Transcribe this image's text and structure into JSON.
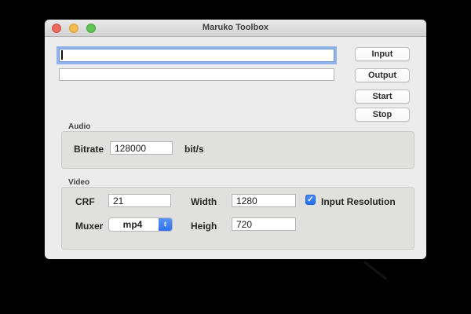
{
  "window": {
    "title": "Maruko Toolbox"
  },
  "paths": {
    "input_field": {
      "value": "",
      "focused": true
    },
    "output_field": {
      "value": ""
    }
  },
  "buttons": {
    "input": "Input",
    "output": "Output",
    "start": "Start",
    "stop": "Stop"
  },
  "audio": {
    "label": "Audio",
    "bitrate_label": "Bitrate",
    "bitrate_value": "128000",
    "bitrate_unit": "bit/s"
  },
  "video": {
    "label": "Video",
    "crf_label": "CRF",
    "crf_value": "21",
    "width_label": "Width",
    "width_value": "1280",
    "input_resolution_label": "Input Resolution",
    "input_resolution_checked": true,
    "muxer_label": "Muxer",
    "muxer_value": "mp4",
    "height_label": "Heigh",
    "height_value": "720"
  },
  "icons": {
    "check": "✓",
    "stepper_up": "▲",
    "stepper_down": "▼"
  },
  "colors": {
    "accent_blue": "#2e7cf6",
    "focus_ring": "#8fb3ea",
    "traffic_red": "#ee6a5f",
    "traffic_yellow": "#f5bd4f",
    "traffic_green": "#61c554",
    "window_bg": "#ececec",
    "groupbox_bg": "#e0e0de"
  }
}
